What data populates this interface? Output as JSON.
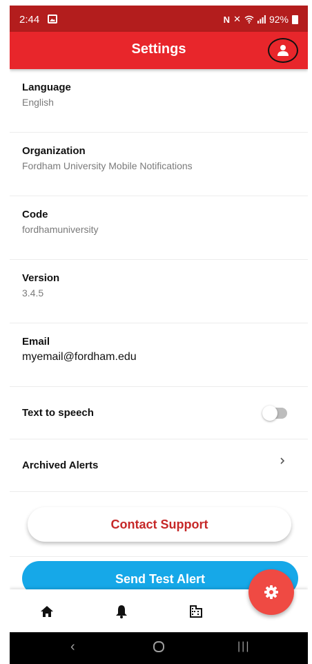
{
  "status_bar": {
    "time": "2:44",
    "battery": "92%",
    "icons": [
      "nfc-icon",
      "mute-icon",
      "wifi-icon",
      "signal-icon",
      "battery-icon"
    ]
  },
  "app_bar": {
    "title": "Settings",
    "profile_icon": "person-icon"
  },
  "settings": {
    "language": {
      "label": "Language",
      "value": "English"
    },
    "organization": {
      "label": "Organization",
      "value": "Fordham University Mobile Notifications"
    },
    "code": {
      "label": "Code",
      "value": "fordhamuniversity"
    },
    "version": {
      "label": "Version",
      "value": "3.4.5"
    },
    "email": {
      "label": "Email",
      "value": "myemail@fordham.edu"
    },
    "text_to_speech": {
      "label": "Text to speech",
      "enabled": false
    },
    "archived_alerts": {
      "label": "Archived Alerts"
    }
  },
  "buttons": {
    "contact_support": "Contact Support",
    "send_test_alert": "Send Test Alert"
  },
  "bottom_nav": {
    "items": [
      "home-icon",
      "bell-icon",
      "building-icon"
    ],
    "fab_icon": "gear-icon"
  },
  "colors": {
    "status_bar": "#b31d1d",
    "app_bar": "#e8262b",
    "contact_text": "#c62828",
    "test_alert": "#16a8e8",
    "fab": "#ef4a43"
  }
}
